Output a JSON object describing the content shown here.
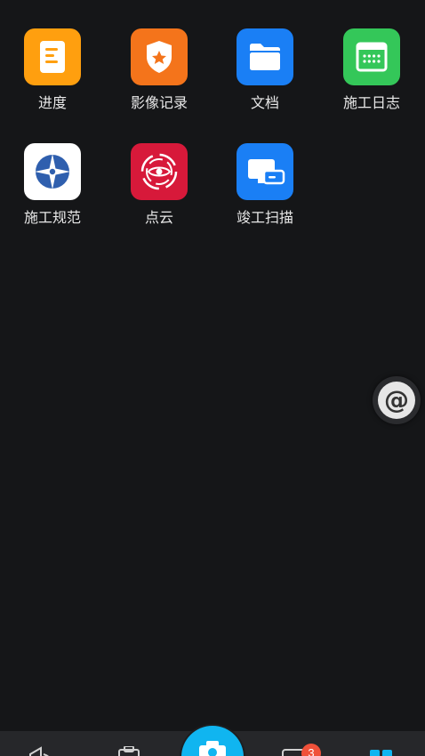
{
  "apps": [
    {
      "label": "进度",
      "icon": "progress-doc-icon",
      "color": "#ff9f0f"
    },
    {
      "label": "影像记录",
      "icon": "shield-star-icon",
      "color": "#f4741b"
    },
    {
      "label": "文档",
      "icon": "folder-icon",
      "color": "#1a7ff5"
    },
    {
      "label": "施工日志",
      "icon": "calendar-icon",
      "color": "#34c759"
    },
    {
      "label": "施工规范",
      "icon": "compass-star-icon",
      "color": "#ffffff"
    },
    {
      "label": "点云",
      "icon": "eye-swirl-icon",
      "color": "#d7193a"
    },
    {
      "label": "竣工扫描",
      "icon": "monitor-device-icon",
      "color": "#1a7ff5"
    }
  ],
  "floating_button": {
    "icon": "at-icon",
    "glyph": "@"
  },
  "tabbar": {
    "tabs": [
      {
        "icon": "megaphone-icon"
      },
      {
        "icon": "clipboard-icon"
      },
      {
        "icon": "camera-icon"
      },
      {
        "icon": "message-icon",
        "badge": "3"
      },
      {
        "icon": "grid-apps-icon"
      }
    ],
    "accent_color": "#10b5f0"
  }
}
